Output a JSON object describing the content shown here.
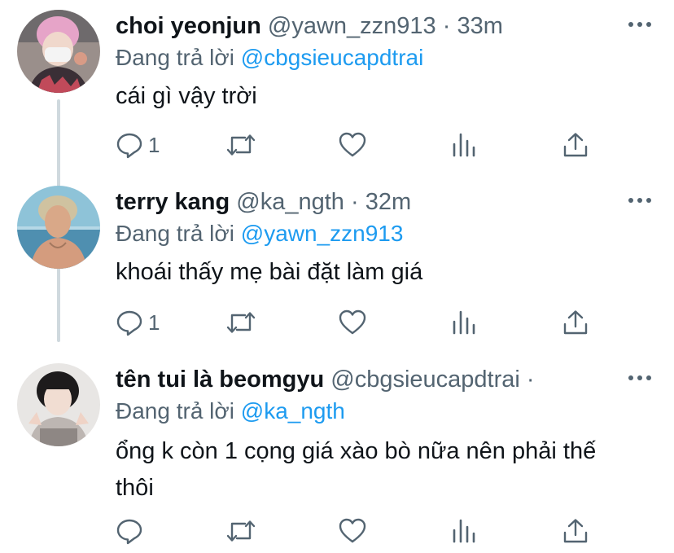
{
  "tweets": [
    {
      "display_name": "choi yeonjun",
      "handle": "@yawn_zzn913",
      "separator": "·",
      "time": "33m",
      "reply_prefix": "Đang trả lời",
      "reply_to": "@cbgsieucapdtrai",
      "text": "cái gì vậy trời",
      "reply_count": "1"
    },
    {
      "display_name": "terry kang",
      "handle": "@ka_ngth",
      "separator": "·",
      "time": "32m",
      "reply_prefix": "Đang trả lời",
      "reply_to": "@yawn_zzn913",
      "text": "khoái thấy mẹ bài đặt làm giá",
      "reply_count": "1"
    },
    {
      "display_name": "tên tui là beomgyu",
      "handle": "@cbgsieucapdtrai",
      "separator": "·",
      "time": "",
      "reply_prefix": "Đang trả lời",
      "reply_to": "@ka_ngth",
      "text": "ổng k còn 1 cọng giá xào bò nữa nên phải thế thôi",
      "reply_count": ""
    }
  ],
  "icons": {
    "reply": "reply-icon",
    "retweet": "retweet-icon",
    "like": "like-icon",
    "views": "views-icon",
    "share": "share-icon",
    "more": "more-icon"
  },
  "colors": {
    "text": "#0f1419",
    "secondary": "#536471",
    "link": "#1d9bf0",
    "thread_line": "#cfd9de"
  }
}
